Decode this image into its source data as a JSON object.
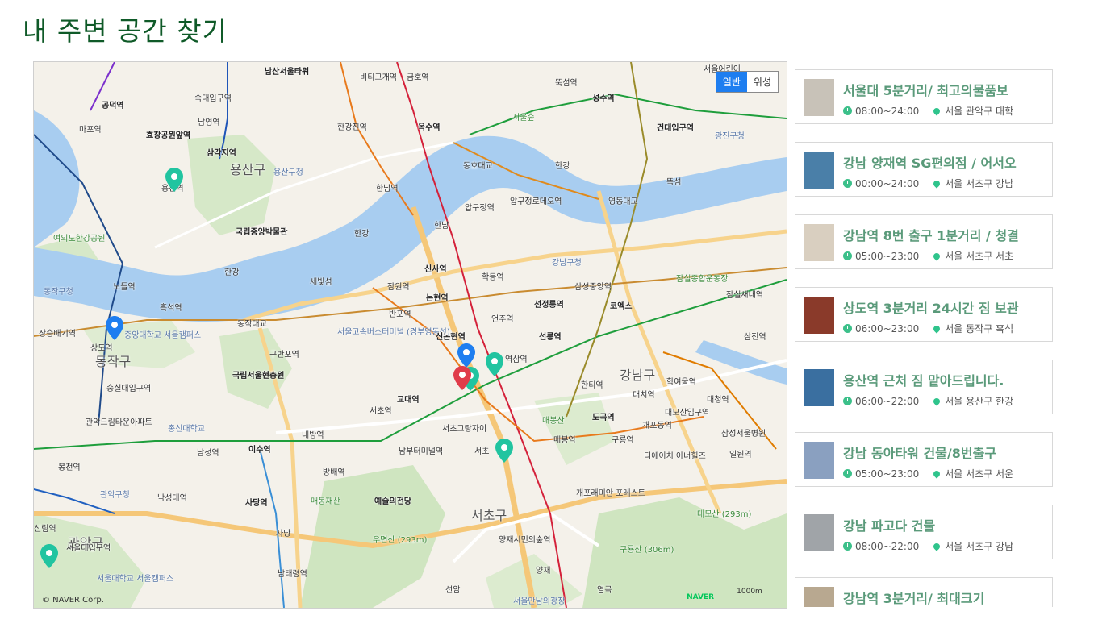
{
  "page_title": "내 주변 공간 찾기",
  "map": {
    "type_buttons": [
      {
        "label": "일반",
        "active": true
      },
      {
        "label": "위성",
        "active": false
      }
    ],
    "copyright": "© NAVER Corp.",
    "naver_logo": "NAVER",
    "scale": "1000m",
    "districts": [
      "용산구",
      "동작구",
      "강남구",
      "서초구",
      "관악구"
    ],
    "labels": {
      "l1": "남산서울타워",
      "l2": "비티고개역",
      "l3": "금호역",
      "l4": "뚝섬역",
      "l5": "성수역",
      "l6": "서울어린이",
      "l7": "숙대입구역",
      "l8": "남영역",
      "l9": "한강진역",
      "l10": "옥수역",
      "l11": "서울숲",
      "l12": "건대입구역",
      "l13": "공덕역",
      "l14": "마포역",
      "l15": "효창공원앞역",
      "l16": "삼각지역",
      "l17": "용산구청",
      "l18": "동호대교",
      "l19": "한강",
      "l20": "뚝섬",
      "l21": "광진구청",
      "l22": "한남역",
      "l23": "압구정역",
      "l24": "압구정로데오역",
      "l25": "영동대교",
      "l26": "국립중앙박물관",
      "l27": "한남",
      "l28": "여의도한강공원",
      "l29": "한강",
      "l30": "강남구청",
      "l31": "잠실종합운동장",
      "l32": "신사역",
      "l33": "학동역",
      "l34": "삼성중앙역",
      "l35": "동작구청",
      "l36": "노들역",
      "l37": "세빛섬",
      "l38": "잠원역",
      "l39": "논현역",
      "l40": "선정릉역",
      "l41": "코엑스",
      "l42": "잠실새내역",
      "l43": "흑석역",
      "l44": "동작대교",
      "l45": "반포역",
      "l46": "언주역",
      "l47": "장승배기역",
      "l48": "상도역",
      "l49": "중앙대학교 서울캠퍼스",
      "l50": "서울고속버스터미널 (경부영동선)",
      "l51": "신논현역",
      "l52": "선릉역",
      "l53": "삼전역",
      "l54": "구반포역",
      "l55": "역삼역",
      "l56": "국립서울현충원",
      "l57": "숭실대입구역",
      "l58": "한티역",
      "l59": "학여울역",
      "l60": "대치역",
      "l61": "대청역",
      "l62": "교대역",
      "l63": "서초역",
      "l64": "매봉산",
      "l65": "도곡역",
      "l66": "대모산입구역",
      "l67": "관악드림타운아파트",
      "l68": "총신대학교",
      "l69": "서초그랑자이",
      "l70": "내방역",
      "l71": "개포동역",
      "l72": "삼성서울병원",
      "l73": "남성역",
      "l74": "이수역",
      "l75": "남부터미널역",
      "l76": "서초",
      "l77": "매봉역",
      "l78": "구룡역",
      "l79": "디에이치 아너힐즈",
      "l80": "일원역",
      "l81": "봉천역",
      "l82": "방배역",
      "l83": "관악구청",
      "l84": "낙성대역",
      "l85": "매봉재산",
      "l86": "예술의전당",
      "l87": "개포래미안 포레스트",
      "l88": "대모산 (293m)",
      "l89": "사당역",
      "l90": "사당",
      "l91": "우면산 (293m)",
      "l92": "양재시민의숲역",
      "l93": "구룡산 (306m)",
      "l94": "서울대입구역",
      "l95": "남태령역",
      "l96": "양재",
      "l97": "서울대학교 서울캠퍼스",
      "l98": "선암",
      "l99": "염곡",
      "l100": "서울만남의광장",
      "l101": "신림역",
      "l102": "한강",
      "l103": "용산역",
      "l104": "관악구"
    }
  },
  "listings": [
    {
      "title": "서울대 5분거리/ 최고의물품보",
      "hours": "08:00~24:00",
      "location": "서울 관악구 대학",
      "thumb_color": "#c8c2b8"
    },
    {
      "title": "강남 양재역 SG편의점 / 어서오",
      "hours": "00:00~24:00",
      "location": "서울 서초구 강남",
      "thumb_color": "#4a7fa8"
    },
    {
      "title": "강남역 8번 출구 1분거리 / 청결",
      "hours": "05:00~23:00",
      "location": "서울 서초구 서초",
      "thumb_color": "#d9cfc0"
    },
    {
      "title": "상도역 3분거리 24시간 짐 보관",
      "hours": "06:00~23:00",
      "location": "서울 동작구 흑석",
      "thumb_color": "#8a3a2a"
    },
    {
      "title": "용산역 근처 짐 맡아드립니다.",
      "hours": "06:00~22:00",
      "location": "서울 용산구 한강",
      "thumb_color": "#3a6fa0"
    },
    {
      "title": "강남 동아타워 건물/8번출구",
      "hours": "05:00~23:00",
      "location": "서울 서초구 서운",
      "thumb_color": "#8aa0c0"
    },
    {
      "title": "강남 파고다 건물",
      "hours": "08:00~22:00",
      "location": "서울 서초구 강남",
      "thumb_color": "#a0a4a8"
    },
    {
      "title": "강남역 3분거리/ 최대크기",
      "hours": "",
      "location": "",
      "thumb_color": "#b8a890"
    }
  ]
}
